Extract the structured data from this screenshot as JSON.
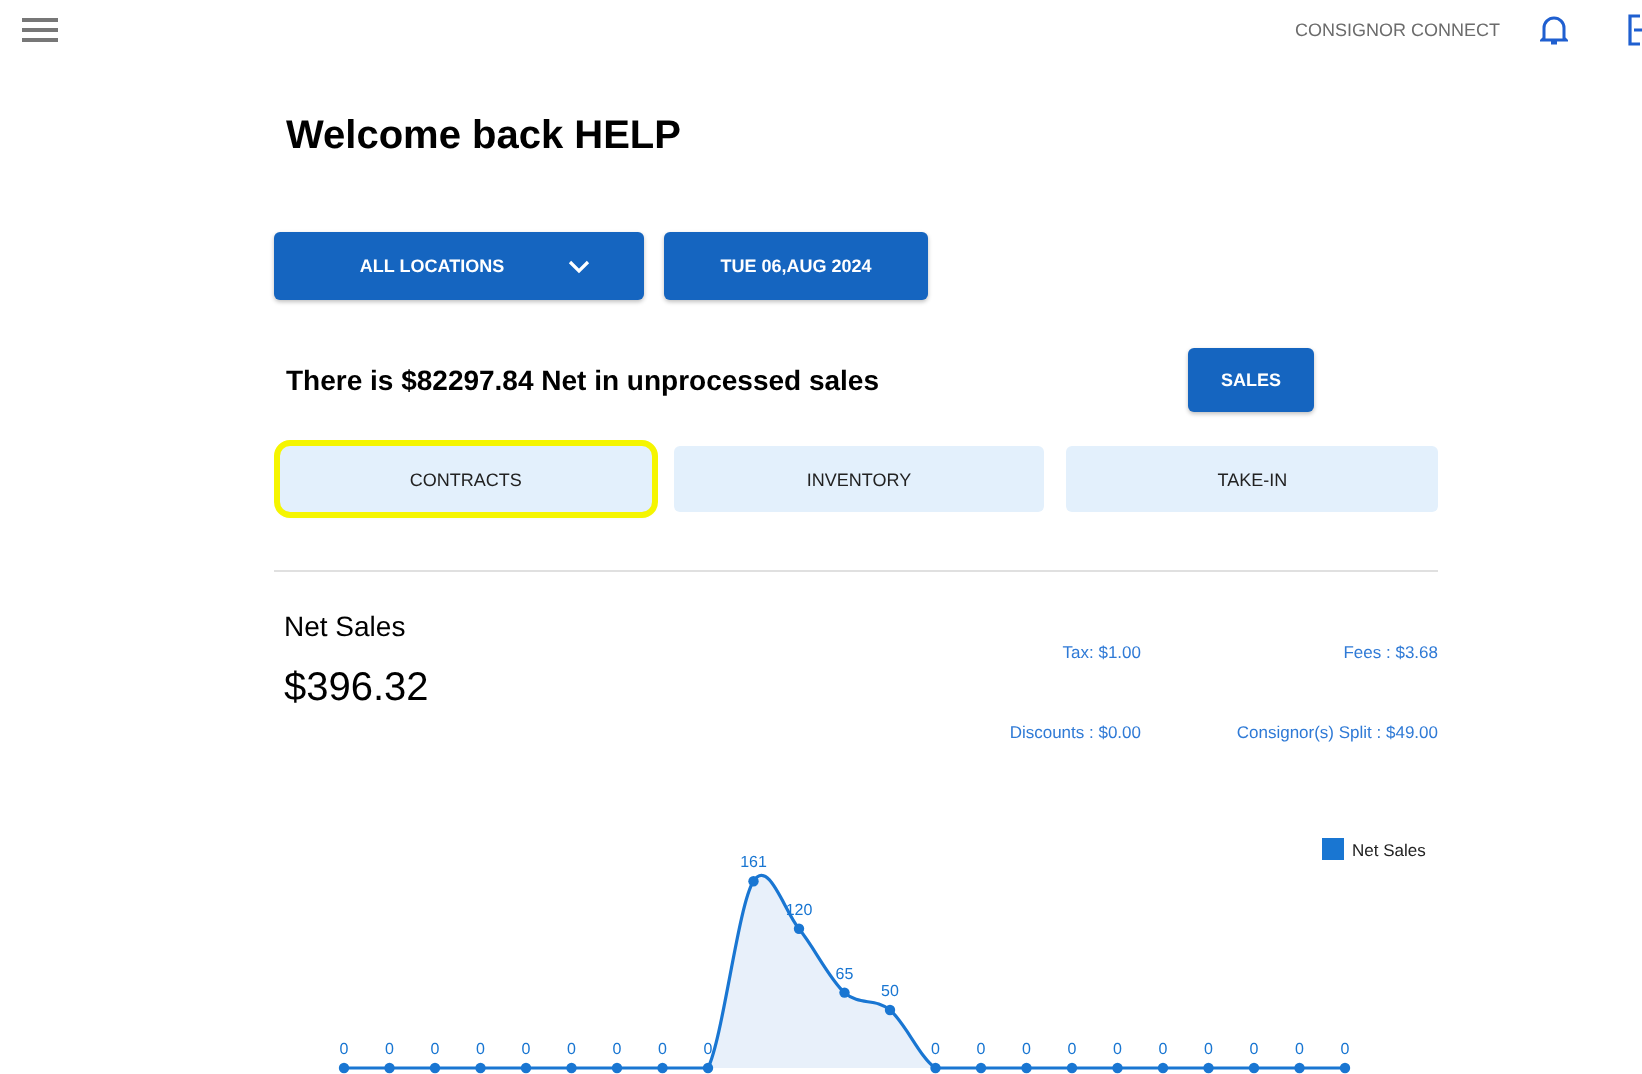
{
  "header": {
    "app_name": "CONSIGNOR CONNECT"
  },
  "greeting": "Welcome back HELP",
  "filters": {
    "location": "ALL LOCATIONS",
    "date": "TUE 06,AUG 2024"
  },
  "unprocessed": {
    "text": "There is $82297.84 Net in unprocessed sales",
    "button": "SALES"
  },
  "tabs": [
    {
      "label": "CONTRACTS",
      "selected": true
    },
    {
      "label": "INVENTORY",
      "selected": false
    },
    {
      "label": "TAKE-IN",
      "selected": false
    }
  ],
  "net_sales": {
    "title": "Net Sales",
    "amount": "$396.32",
    "stats": [
      {
        "label": "Tax: $1.00"
      },
      {
        "label": "Fees : $3.68"
      },
      {
        "label": "Discounts : $0.00"
      },
      {
        "label": "Consignor(s) Split : $49.00"
      }
    ],
    "chart_data": {
      "type": "area",
      "data_labels": true,
      "series": [
        {
          "name": "Net Sales",
          "color": "#1976d2",
          "values": [
            0,
            0,
            0,
            0,
            0,
            0,
            0,
            0,
            0,
            161,
            120,
            65,
            50,
            0,
            0,
            0,
            0,
            0,
            0,
            0,
            0,
            0,
            0
          ]
        }
      ]
    }
  }
}
